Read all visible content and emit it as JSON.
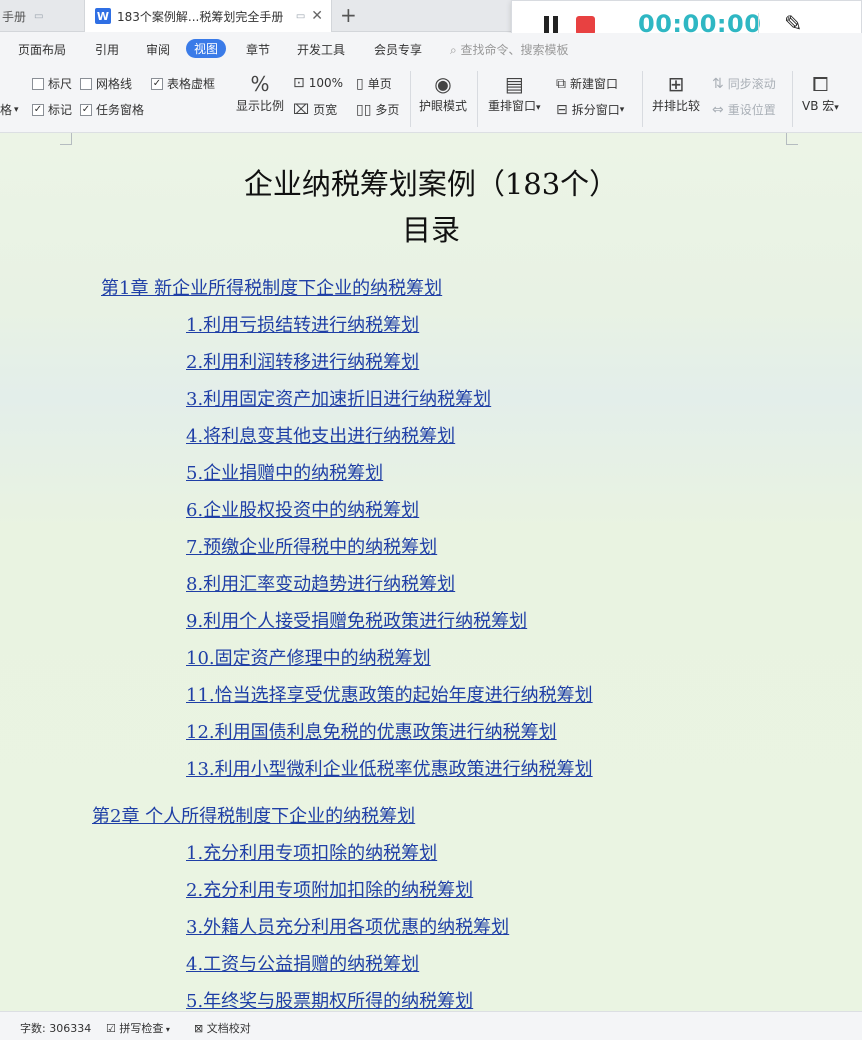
{
  "tabs": {
    "prev_label": "手册",
    "active_title": "183个案例解...税筹划完全手册",
    "app_logo": "W"
  },
  "recorder": {
    "time": "00:00:00"
  },
  "menu": {
    "items": [
      "页面布局",
      "引用",
      "审阅",
      "视图",
      "章节",
      "开发工具",
      "会员专享"
    ],
    "search": "查找命令、搜索模板"
  },
  "toolbar": {
    "ruler": "标尺",
    "gridlines": "网格线",
    "table_gridlines": "表格虚框",
    "cut_left": "格",
    "marks": "标记",
    "task_pane": "任务窗格",
    "display_ratio": "显示比例",
    "zoom_100": "100%",
    "page_width": "页宽",
    "single_page": "单页",
    "multi_page": "多页",
    "eye_mode": "护眼模式",
    "rearrange": "重排窗口",
    "new_window": "新建窗口",
    "split_window": "拆分窗口",
    "compare": "并排比较",
    "sync_scroll": "同步滚动",
    "reset_position": "重设位置",
    "vb_macro": "VB 宏"
  },
  "document": {
    "title": "企业纳税筹划案例（183个）",
    "subtitle": "目录",
    "chapter1": "第1章  新企业所得税制度下企业的纳税筹划",
    "chapter1_items": [
      "1.利用亏损结转进行纳税筹划",
      "2.利用利润转移进行纳税筹划",
      "3.利用固定资产加速折旧进行纳税筹划",
      "4.将利息变其他支出进行纳税筹划",
      "5.企业捐赠中的纳税筹划",
      "6.企业股权投资中的纳税筹划",
      "7.预缴企业所得税中的纳税筹划",
      "8.利用汇率变动趋势进行纳税筹划",
      "9.利用个人接受捐赠免税政策进行纳税筹划",
      "10.固定资产修理中的纳税筹划",
      "11.恰当选择享受优惠政策的起始年度进行纳税筹划",
      "12.利用国债利息免税的优惠政策进行纳税筹划",
      "13.利用小型微利企业低税率优惠政策进行纳税筹划"
    ],
    "chapter2": "第2章  个人所得税制度下企业的纳税筹划",
    "chapter2_items": [
      "1.充分利用专项扣除的纳税筹划",
      "2.充分利用专项附加扣除的纳税筹划",
      "3.外籍人员充分利用各项优惠的纳税筹划",
      "4.工资与公益捐赠的纳税筹划",
      "5.年终奖与股票期权所得的纳税筹划"
    ]
  },
  "status": {
    "word_count": "字数: 306334",
    "spell_check": "拼写检查",
    "doc_proof": "文档校对"
  }
}
